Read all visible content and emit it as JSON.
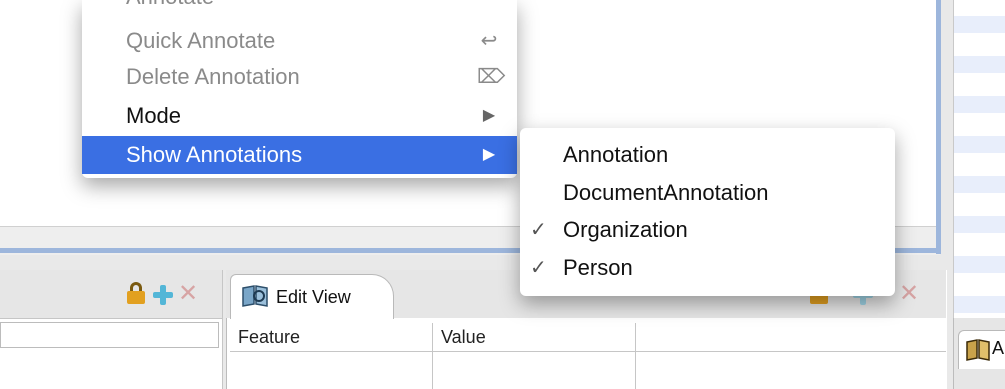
{
  "context_menu": {
    "items": [
      {
        "label": "Annotate",
        "shortcut_icon": "keyboard-shortcut",
        "enabled": false
      },
      {
        "label": "Quick Annotate",
        "shortcut_icon": "return-key",
        "shortcut_glyph": "↩",
        "enabled": false
      },
      {
        "label": "Delete Annotation",
        "shortcut_icon": "delete-key",
        "shortcut_glyph": "⌦",
        "enabled": false
      },
      {
        "label": "Mode",
        "shortcut_icon": "submenu-arrow",
        "shortcut_glyph": "▶",
        "enabled": true
      },
      {
        "label": "Show Annotations",
        "shortcut_icon": "submenu-arrow",
        "shortcut_glyph": "▶",
        "enabled": true,
        "highlighted": true
      }
    ]
  },
  "submenu": {
    "items": [
      {
        "label": "Annotation",
        "checked": false
      },
      {
        "label": "DocumentAnnotation",
        "checked": false
      },
      {
        "label": "Organization",
        "checked": true,
        "check_glyph": "✓"
      },
      {
        "label": "Person",
        "checked": true,
        "check_glyph": "✓"
      }
    ]
  },
  "edit_view": {
    "tab_label": "Edit View",
    "columns": [
      "Feature",
      "Value"
    ]
  },
  "right_view": {
    "tab_label": "A"
  },
  "toolbar_icons": [
    "lock-icon",
    "add-icon",
    "remove-icon"
  ],
  "colors": {
    "highlight": "#3a6fe3",
    "accent_blue": "#9db6dc",
    "disabled_text": "#8a8a8a"
  }
}
